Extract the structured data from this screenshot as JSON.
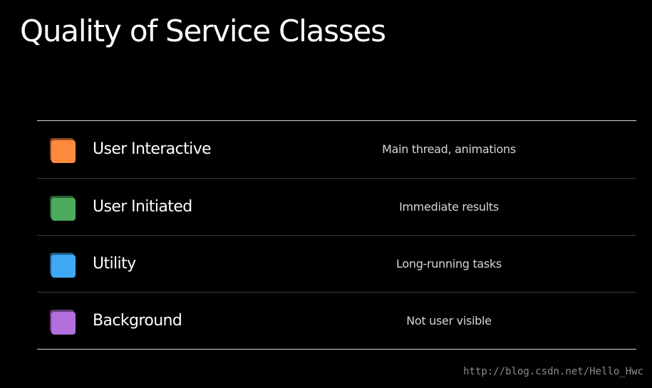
{
  "slide": {
    "title": "Quality of Service Classes"
  },
  "classes": [
    {
      "name": "User Interactive",
      "description": "Main thread, animations",
      "color": "#ff8a3d",
      "icon": "orange-square-icon"
    },
    {
      "name": "User Initiated",
      "description": "Immediate results",
      "color": "#4caa5c",
      "icon": "green-square-icon"
    },
    {
      "name": "Utility",
      "description": "Long-running tasks",
      "color": "#3fa9f5",
      "icon": "blue-square-icon"
    },
    {
      "name": "Background",
      "description": "Not user visible",
      "color": "#b26fdc",
      "icon": "purple-square-icon"
    }
  ],
  "watermark": {
    "text": "http://blog.csdn.net/Hello_Hwc"
  }
}
